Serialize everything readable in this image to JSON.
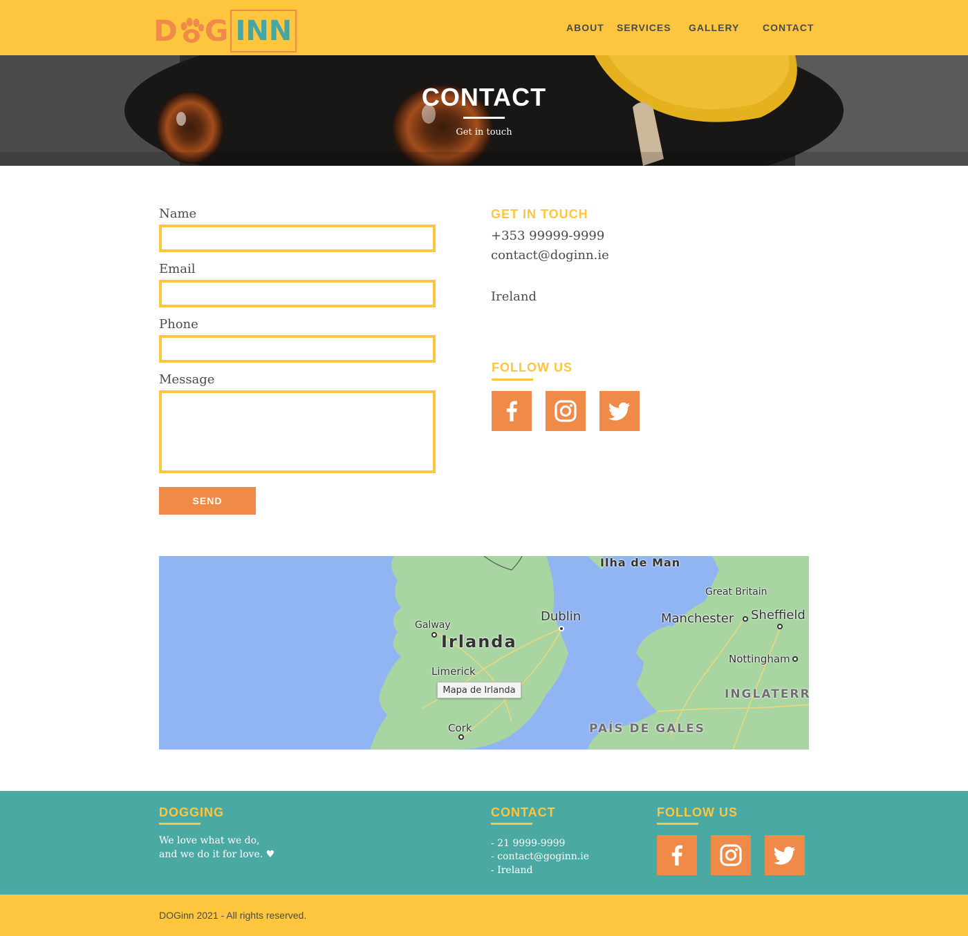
{
  "brand": {
    "logo_dog": "DOG",
    "logo_inn": "INN"
  },
  "nav": {
    "items": [
      "ABOUT",
      "SERVICES",
      "GALLERY",
      "CONTACT"
    ]
  },
  "hero": {
    "title": "CONTACT",
    "subtitle": "Get in touch"
  },
  "form": {
    "name_label": "Name",
    "email_label": "Email",
    "phone_label": "Phone",
    "message_label": "Message",
    "name_value": "",
    "email_value": "",
    "phone_value": "",
    "message_value": "",
    "send_label": "SEND"
  },
  "contact_info": {
    "heading": "GET IN TOUCH",
    "phone": "+353 99999-9999",
    "email": "contact@doginn.ie",
    "country": "Ireland",
    "follow_heading": "FOLLOW US"
  },
  "map": {
    "tooltip": "Mapa de Irlanda",
    "labels": {
      "isle_of_man": "Ilha de Man",
      "great_britain": "Great Britain",
      "galway": "Galway",
      "dublin": "Dublin",
      "irlanda": "Irlanda",
      "manchester": "Manchester",
      "sheffield": "Sheffield",
      "limerick": "Limerick",
      "nottingham": "Nottingham",
      "inglaterra": "INGLATERR",
      "cork": "Cork",
      "pais_de_gales": "PAÍS DE GALES"
    }
  },
  "footer": {
    "brand_heading": "DOGGING",
    "brand_text_1": "We love what we do,",
    "brand_text_2": "and we do it for love. ♥",
    "contact_heading": "CONTACT",
    "contact_phone": "- 21 9999-9999",
    "contact_email": "- contact@goginn.ie",
    "contact_country": "- Ireland",
    "follow_heading": "FOLLOW US",
    "copyright": "DOGinn 2021 - All rights reserved."
  },
  "colors": {
    "yellow": "#fec53f",
    "orange": "#ef8a48",
    "teal": "#4ba9a3",
    "logo_teal": "#45a6a6"
  },
  "icons": [
    "paw-icon",
    "facebook-icon",
    "instagram-icon",
    "twitter-icon"
  ]
}
